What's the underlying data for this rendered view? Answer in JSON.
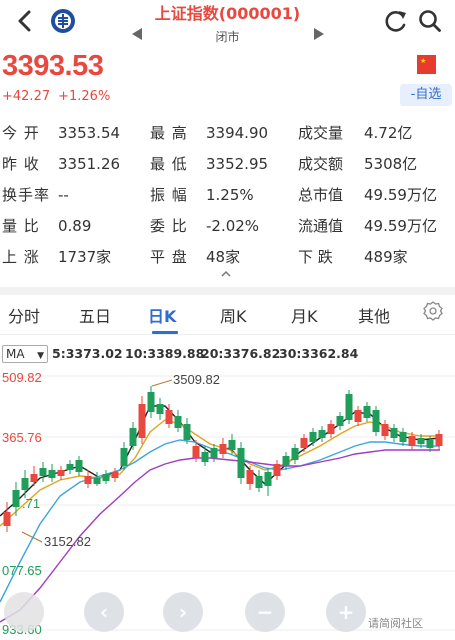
{
  "header": {
    "title": "上证指数(000001)",
    "subtitle": "闭市"
  },
  "quote": {
    "price": "3393.53",
    "change": "+42.27",
    "change_pct": "+1.26%",
    "fav_label": "-自选"
  },
  "stats": [
    {
      "label": "今 开",
      "value": "3353.54"
    },
    {
      "label": "最 高",
      "value": "3394.90"
    },
    {
      "label": "成交量",
      "value": "4.72亿"
    },
    {
      "label": "昨 收",
      "value": "3351.26"
    },
    {
      "label": "最 低",
      "value": "3352.95"
    },
    {
      "label": "成交额",
      "value": "5308亿"
    },
    {
      "label": "换手率",
      "value": "--"
    },
    {
      "label": "振 幅",
      "value": "1.25%"
    },
    {
      "label": "总市值",
      "value": "49.59万亿"
    },
    {
      "label": "量 比",
      "value": "0.89"
    },
    {
      "label": "委 比",
      "value": "-2.02%"
    },
    {
      "label": "流通值",
      "value": "49.59万亿"
    },
    {
      "label": "上 涨",
      "value": "1737家"
    },
    {
      "label": "平 盘",
      "value": "48家"
    },
    {
      "label": "下 跌",
      "value": "489家"
    }
  ],
  "tabs": [
    "分时",
    "五日",
    "日K",
    "周K",
    "月K",
    "其他"
  ],
  "active_tab": "日K",
  "ma": {
    "selector": "MA",
    "items": [
      {
        "text": "5:3373.02",
        "color": "#222222"
      },
      {
        "text": "10:3389.88",
        "color": "#e0a421"
      },
      {
        "text": "20:3376.82",
        "color": "#3ea6dc"
      },
      {
        "text": "30:3362.84",
        "color": "#a03cc4"
      }
    ]
  },
  "chart_labels": {
    "y_top": "509.82",
    "y_mid": "365.76",
    "y_low1": ".71",
    "y_low2": "077.65",
    "y_bottom": "933.60",
    "high_marker": "3509.82",
    "low_marker": "3152.82"
  },
  "colors": {
    "up": "#e8483e",
    "down": "#1f9e5b",
    "accent": "#2f6ecf"
  },
  "watermark": "请简阅社区"
}
